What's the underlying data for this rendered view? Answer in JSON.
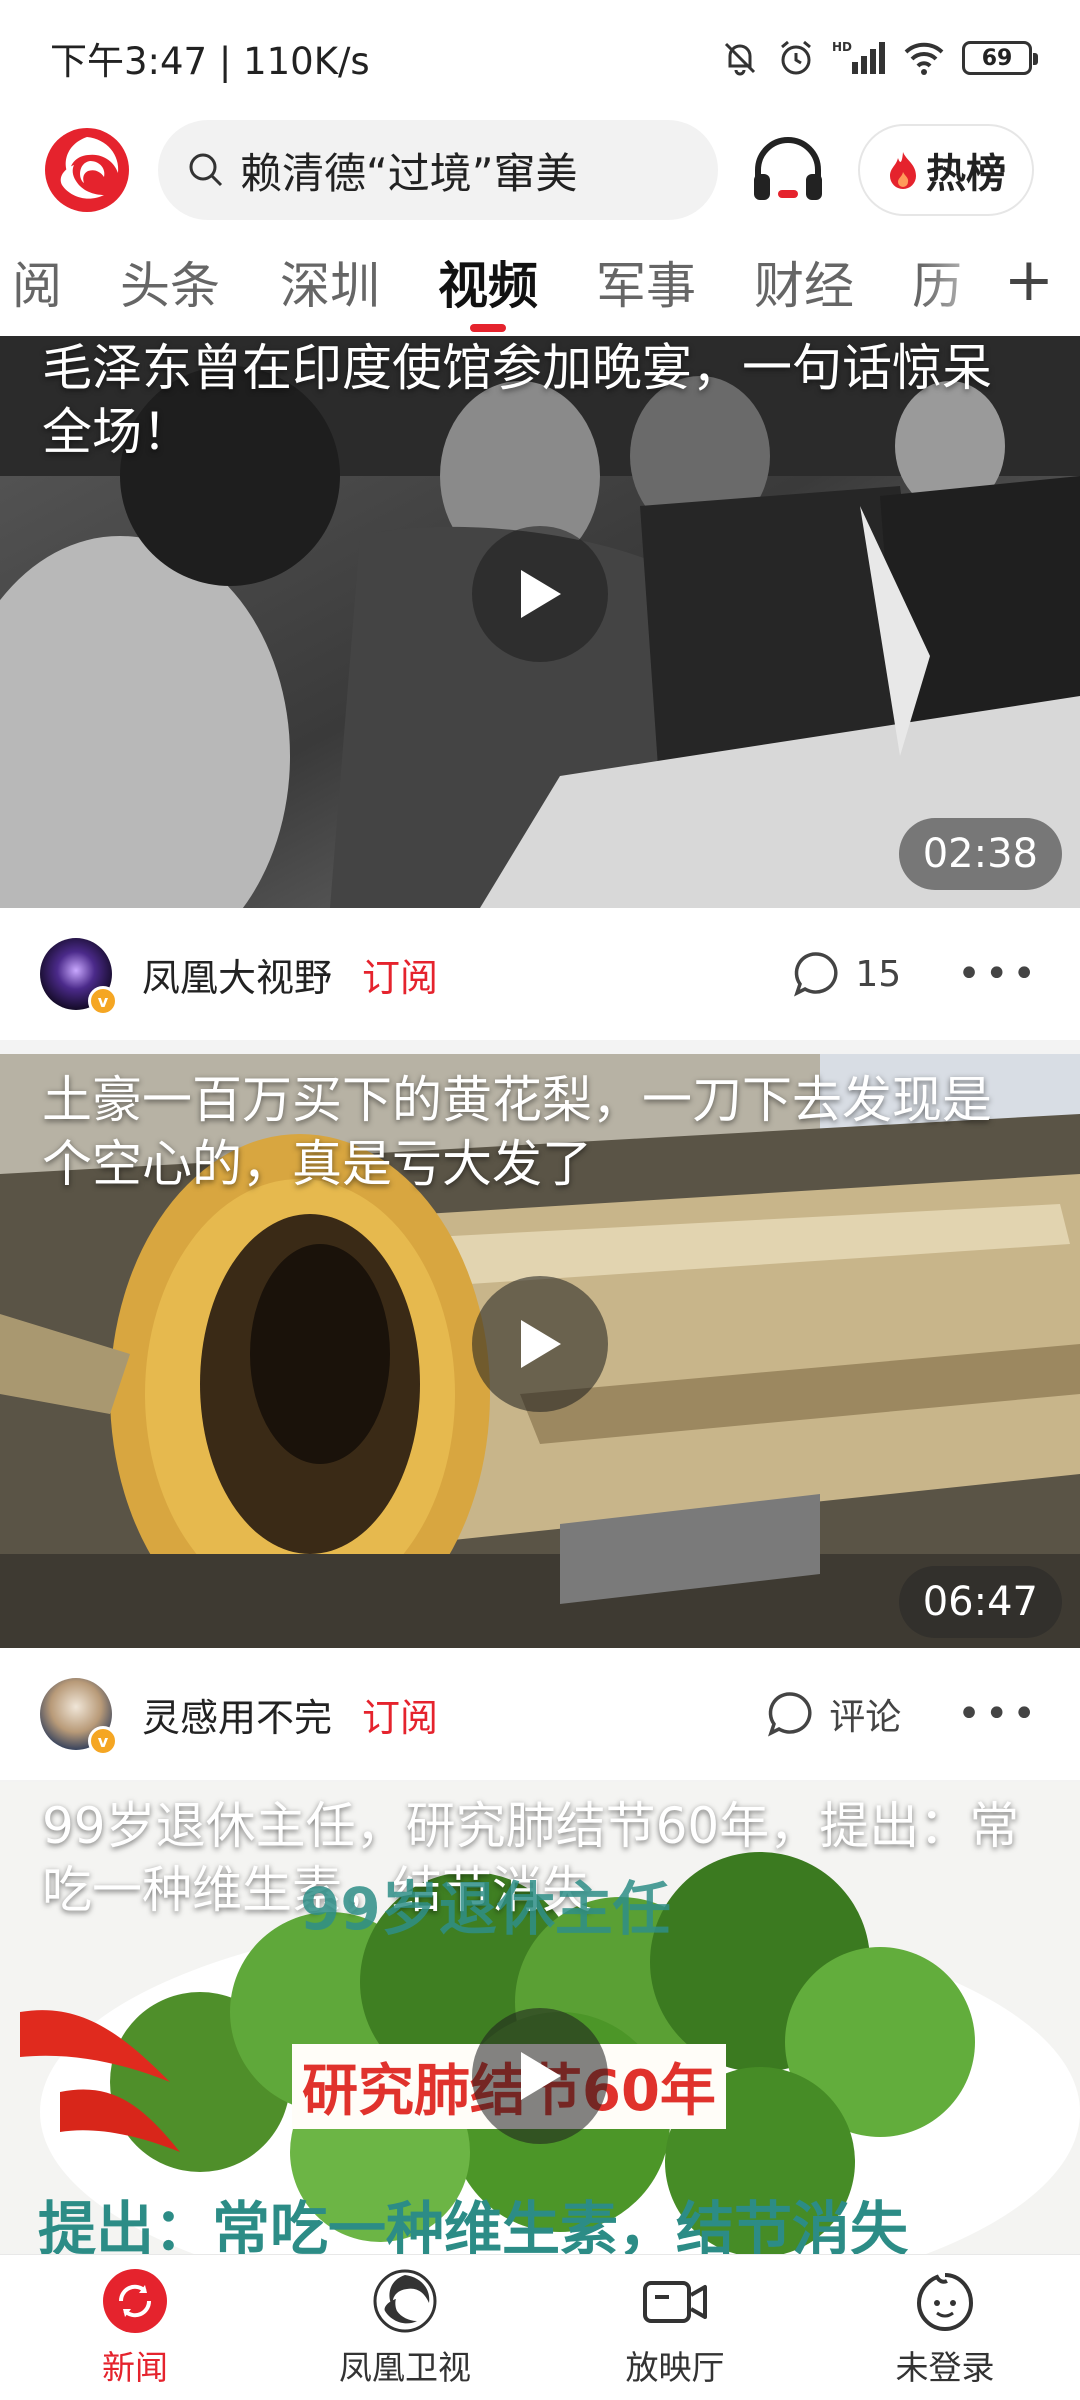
{
  "status_bar": {
    "time_speed": "下午3:47 | 110K/s",
    "battery": "69",
    "network_badge": "HD"
  },
  "header": {
    "search_text": "赖清德“过境”窜美",
    "hot_label": "热榜"
  },
  "tabs": [
    "阅",
    "头条",
    "深圳",
    "视频",
    "军事",
    "财经",
    "历"
  ],
  "active_tab": "视频",
  "videos": [
    {
      "title": "毛泽东曾在印度使馆参加晚宴，一句话惊呆全场！",
      "duration": "02:38",
      "author": "凤凰大视野",
      "subscribe": "订阅",
      "comments": "15"
    },
    {
      "title": "土豪一百万买下的黄花梨，一刀下去发现是个空心的，真是亏大发了",
      "duration": "06:47",
      "author": "灵感用不完",
      "subscribe": "订阅",
      "comments": "评论"
    },
    {
      "title": "99岁退休主任，研究肺结节60年，提出：常吃一种维生素，结节消失",
      "overlay_top": "99岁退休主任",
      "overlay_mid": "研究肺结节60年",
      "overlay_bottom": "提出：常吃一种维生素，结节消失"
    }
  ],
  "bottom_nav": [
    {
      "label": "新闻",
      "icon": "news-refresh-icon"
    },
    {
      "label": "凤凰卫视",
      "icon": "phoenix-tv-icon"
    },
    {
      "label": "放映厅",
      "icon": "video-camera-icon"
    },
    {
      "label": "未登录",
      "icon": "user-face-icon"
    }
  ],
  "colors": {
    "accent": "#e5232d",
    "tab_inactive": "#666666",
    "nav_text": "#333333"
  }
}
